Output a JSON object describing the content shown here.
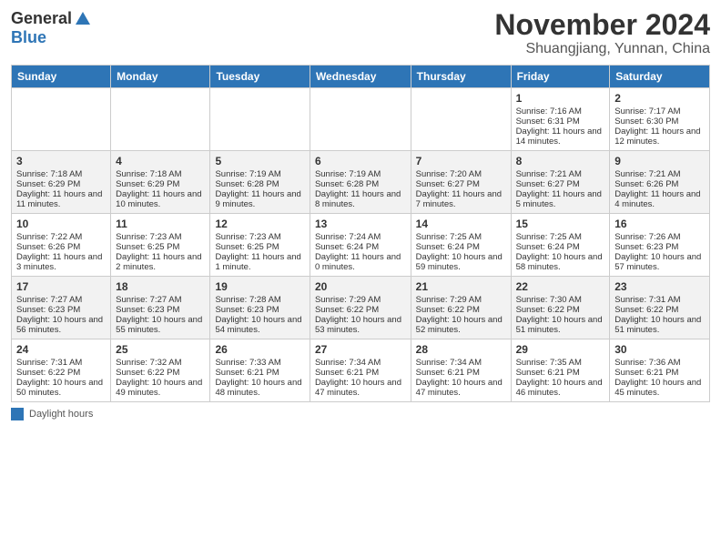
{
  "logo": {
    "general": "General",
    "blue": "Blue"
  },
  "header": {
    "month": "November 2024",
    "location": "Shuangjiang, Yunnan, China"
  },
  "weekdays": [
    "Sunday",
    "Monday",
    "Tuesday",
    "Wednesday",
    "Thursday",
    "Friday",
    "Saturday"
  ],
  "weeks": [
    [
      {
        "day": "",
        "info": ""
      },
      {
        "day": "",
        "info": ""
      },
      {
        "day": "",
        "info": ""
      },
      {
        "day": "",
        "info": ""
      },
      {
        "day": "",
        "info": ""
      },
      {
        "day": "1",
        "info": "Sunrise: 7:16 AM\nSunset: 6:31 PM\nDaylight: 11 hours and 14 minutes."
      },
      {
        "day": "2",
        "info": "Sunrise: 7:17 AM\nSunset: 6:30 PM\nDaylight: 11 hours and 12 minutes."
      }
    ],
    [
      {
        "day": "3",
        "info": "Sunrise: 7:18 AM\nSunset: 6:29 PM\nDaylight: 11 hours and 11 minutes."
      },
      {
        "day": "4",
        "info": "Sunrise: 7:18 AM\nSunset: 6:29 PM\nDaylight: 11 hours and 10 minutes."
      },
      {
        "day": "5",
        "info": "Sunrise: 7:19 AM\nSunset: 6:28 PM\nDaylight: 11 hours and 9 minutes."
      },
      {
        "day": "6",
        "info": "Sunrise: 7:19 AM\nSunset: 6:28 PM\nDaylight: 11 hours and 8 minutes."
      },
      {
        "day": "7",
        "info": "Sunrise: 7:20 AM\nSunset: 6:27 PM\nDaylight: 11 hours and 7 minutes."
      },
      {
        "day": "8",
        "info": "Sunrise: 7:21 AM\nSunset: 6:27 PM\nDaylight: 11 hours and 5 minutes."
      },
      {
        "day": "9",
        "info": "Sunrise: 7:21 AM\nSunset: 6:26 PM\nDaylight: 11 hours and 4 minutes."
      }
    ],
    [
      {
        "day": "10",
        "info": "Sunrise: 7:22 AM\nSunset: 6:26 PM\nDaylight: 11 hours and 3 minutes."
      },
      {
        "day": "11",
        "info": "Sunrise: 7:23 AM\nSunset: 6:25 PM\nDaylight: 11 hours and 2 minutes."
      },
      {
        "day": "12",
        "info": "Sunrise: 7:23 AM\nSunset: 6:25 PM\nDaylight: 11 hours and 1 minute."
      },
      {
        "day": "13",
        "info": "Sunrise: 7:24 AM\nSunset: 6:24 PM\nDaylight: 11 hours and 0 minutes."
      },
      {
        "day": "14",
        "info": "Sunrise: 7:25 AM\nSunset: 6:24 PM\nDaylight: 10 hours and 59 minutes."
      },
      {
        "day": "15",
        "info": "Sunrise: 7:25 AM\nSunset: 6:24 PM\nDaylight: 10 hours and 58 minutes."
      },
      {
        "day": "16",
        "info": "Sunrise: 7:26 AM\nSunset: 6:23 PM\nDaylight: 10 hours and 57 minutes."
      }
    ],
    [
      {
        "day": "17",
        "info": "Sunrise: 7:27 AM\nSunset: 6:23 PM\nDaylight: 10 hours and 56 minutes."
      },
      {
        "day": "18",
        "info": "Sunrise: 7:27 AM\nSunset: 6:23 PM\nDaylight: 10 hours and 55 minutes."
      },
      {
        "day": "19",
        "info": "Sunrise: 7:28 AM\nSunset: 6:23 PM\nDaylight: 10 hours and 54 minutes."
      },
      {
        "day": "20",
        "info": "Sunrise: 7:29 AM\nSunset: 6:22 PM\nDaylight: 10 hours and 53 minutes."
      },
      {
        "day": "21",
        "info": "Sunrise: 7:29 AM\nSunset: 6:22 PM\nDaylight: 10 hours and 52 minutes."
      },
      {
        "day": "22",
        "info": "Sunrise: 7:30 AM\nSunset: 6:22 PM\nDaylight: 10 hours and 51 minutes."
      },
      {
        "day": "23",
        "info": "Sunrise: 7:31 AM\nSunset: 6:22 PM\nDaylight: 10 hours and 51 minutes."
      }
    ],
    [
      {
        "day": "24",
        "info": "Sunrise: 7:31 AM\nSunset: 6:22 PM\nDaylight: 10 hours and 50 minutes."
      },
      {
        "day": "25",
        "info": "Sunrise: 7:32 AM\nSunset: 6:22 PM\nDaylight: 10 hours and 49 minutes."
      },
      {
        "day": "26",
        "info": "Sunrise: 7:33 AM\nSunset: 6:21 PM\nDaylight: 10 hours and 48 minutes."
      },
      {
        "day": "27",
        "info": "Sunrise: 7:34 AM\nSunset: 6:21 PM\nDaylight: 10 hours and 47 minutes."
      },
      {
        "day": "28",
        "info": "Sunrise: 7:34 AM\nSunset: 6:21 PM\nDaylight: 10 hours and 47 minutes."
      },
      {
        "day": "29",
        "info": "Sunrise: 7:35 AM\nSunset: 6:21 PM\nDaylight: 10 hours and 46 minutes."
      },
      {
        "day": "30",
        "info": "Sunrise: 7:36 AM\nSunset: 6:21 PM\nDaylight: 10 hours and 45 minutes."
      }
    ]
  ],
  "legend": {
    "label": "Daylight hours"
  }
}
